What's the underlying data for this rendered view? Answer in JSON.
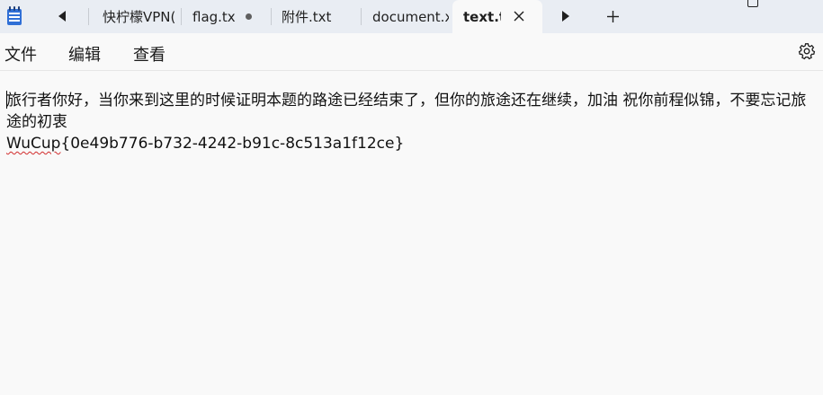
{
  "tabs": [
    {
      "label": "快柠檬VPN(",
      "modified": false,
      "active": false
    },
    {
      "label": "flag.tx",
      "modified": true,
      "active": false
    },
    {
      "label": "附件.txt",
      "modified": false,
      "active": false
    },
    {
      "label": "document.x",
      "modified": false,
      "active": false
    },
    {
      "label": "text.t",
      "modified": false,
      "active": true
    }
  ],
  "menu": {
    "file": "文件",
    "edit": "编辑",
    "view": "查看"
  },
  "document": {
    "line1": "旅行者你好，当你来到这里的时候证明本题的路途已经结束了，但你的旅途还在继续，加油 祝你前程似锦，不要忘记旅途的初衷",
    "flag_prefix": "WuCup",
    "flag_body": "{0e49b776-b732-4242-b91c-8c513a1f12ce}"
  },
  "colors": {
    "tabbar_bg": "#e9edf3",
    "editor_bg": "#f9f9f9",
    "app_icon_blue": "#2f6fd6",
    "spellcheck_red": "#d12b2b"
  },
  "icons": [
    "notepad-app-icon",
    "scroll-left-icon",
    "scroll-right-icon",
    "modified-dot-icon",
    "close-icon",
    "new-tab-icon",
    "maximize-icon",
    "settings-gear-icon"
  ]
}
